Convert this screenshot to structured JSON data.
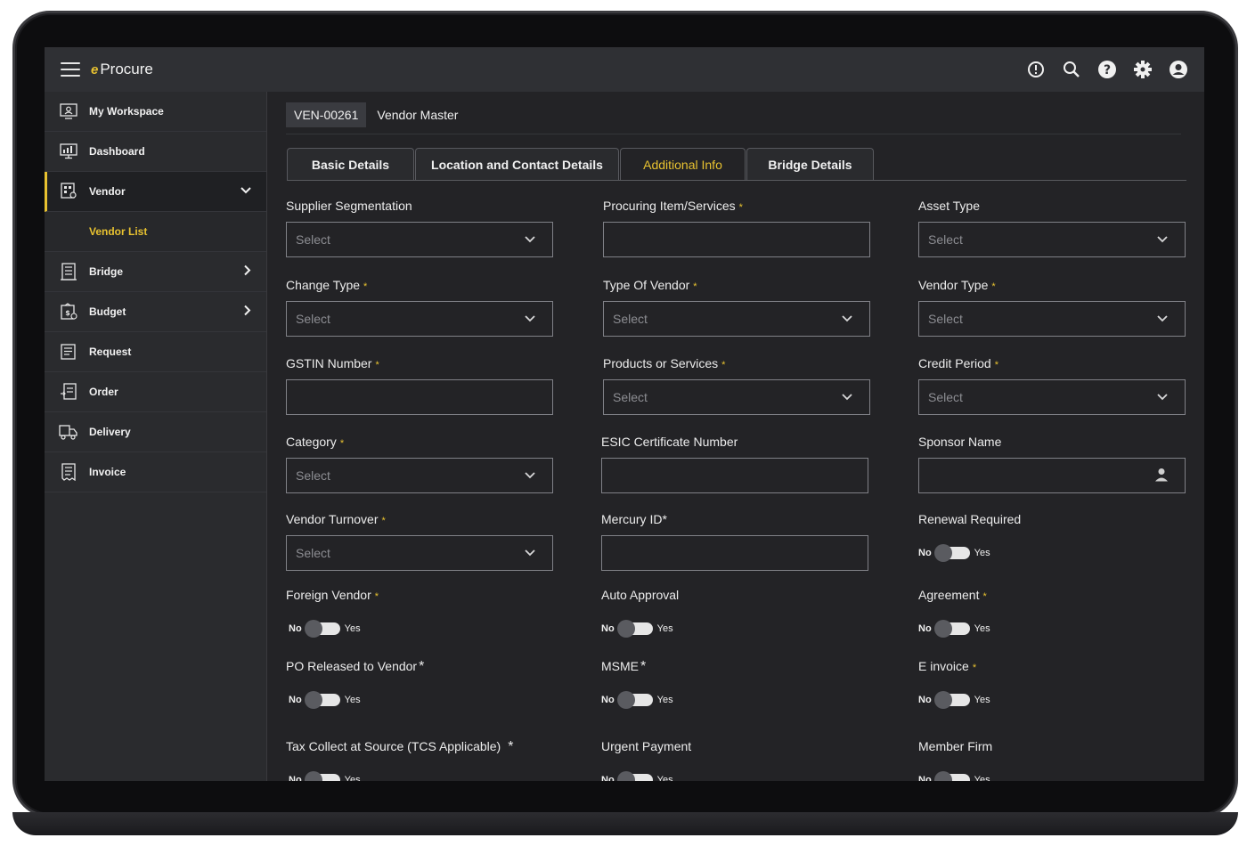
{
  "header": {
    "brand_logo": "e",
    "brand_name": "Procure"
  },
  "sidebar": {
    "items": [
      {
        "label": "My Workspace",
        "icon": "workspace-icon"
      },
      {
        "label": "Dashboard",
        "icon": "dashboard-icon"
      },
      {
        "label": "Vendor",
        "icon": "vendor-icon",
        "expanded": true
      },
      {
        "label": "Vendor List",
        "sub": true
      },
      {
        "label": "Bridge",
        "icon": "bridge-icon"
      },
      {
        "label": "Budget",
        "icon": "budget-icon"
      },
      {
        "label": "Request",
        "icon": "request-icon"
      },
      {
        "label": "Order",
        "icon": "order-icon"
      },
      {
        "label": "Delivery",
        "icon": "delivery-icon"
      },
      {
        "label": "Invoice",
        "icon": "invoice-icon"
      }
    ]
  },
  "page": {
    "vendor_id": "VEN-00261",
    "title": "Vendor Master"
  },
  "tabs": [
    "Basic Details",
    "Location and Contact Details",
    "Additional Info",
    "Bridge Details"
  ],
  "active_tab": "Additional Info",
  "form": {
    "select_placeholder": "Select",
    "toggle_no": "No",
    "toggle_yes": "Yes",
    "fields": {
      "supplier_segmentation": "Supplier Segmentation",
      "procuring_item": "Procuring Item/Services",
      "asset_type": "Asset Type",
      "change_type": "Change Type",
      "type_of_vendor": "Type Of Vendor",
      "vendor_type": "Vendor Type",
      "gstin_number": "GSTIN Number",
      "products_or_services": "Products or Services",
      "credit_period": "Credit Period",
      "category": "Category",
      "esic_certificate": "ESIC Certificate Number",
      "sponsor_name": "Sponsor Name",
      "vendor_turnover": "Vendor Turnover",
      "mercury_id": "Mercury ID*",
      "renewal_required": "Renewal Required",
      "foreign_vendor": "Foreign Vendor",
      "auto_approval": "Auto Approval",
      "agreement": "Agreement",
      "po_released": "PO Released to Vendor",
      "msme": "MSME",
      "e_invoice": "E invoice",
      "tcs_applicable": "Tax Collect at Source (TCS Applicable)",
      "urgent_payment": "Urgent Payment",
      "member_firm": "Member Firm"
    },
    "required_mark": "*"
  },
  "colors": {
    "accent": "#e8c230",
    "background": "#232326",
    "topbar": "#2f3034",
    "sidebar": "#2a2b2e"
  }
}
